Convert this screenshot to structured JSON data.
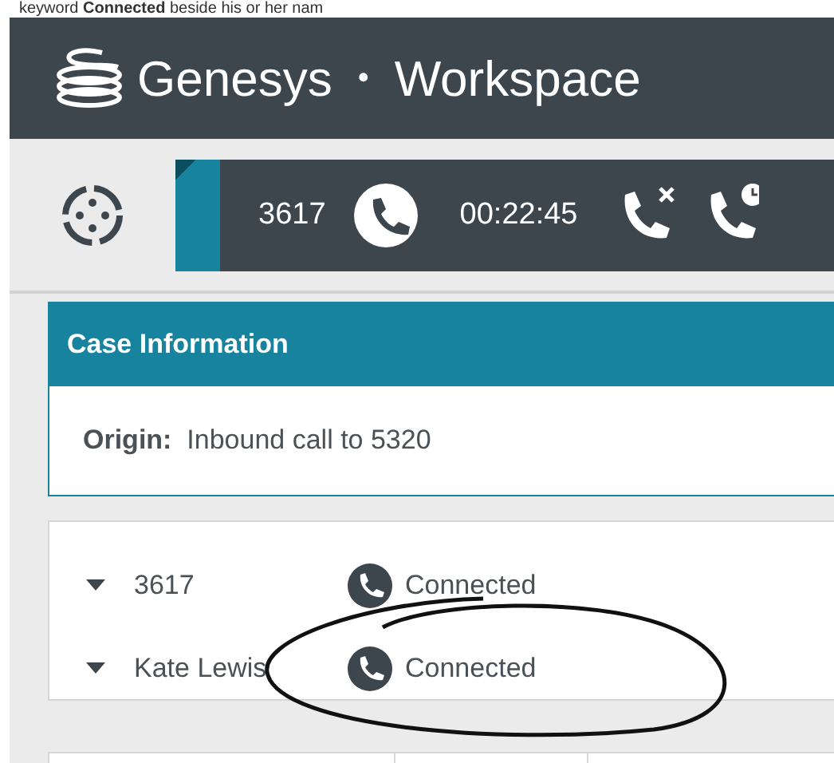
{
  "caption": "keyword **Connected** beside his or her nam",
  "header": {
    "brand": "Genesys",
    "separator": "•",
    "product": "Workspace"
  },
  "interaction": {
    "number": "3617",
    "timer": "00:22:45"
  },
  "case_panel": {
    "title": "Case Information",
    "origin_label": "Origin:",
    "origin_value": "Inbound call to 5320"
  },
  "parties": [
    {
      "name": "3617",
      "status": "Connected",
      "expanded": true
    },
    {
      "name": "Kate Lewis",
      "status": "Connected",
      "expanded": true
    }
  ]
}
